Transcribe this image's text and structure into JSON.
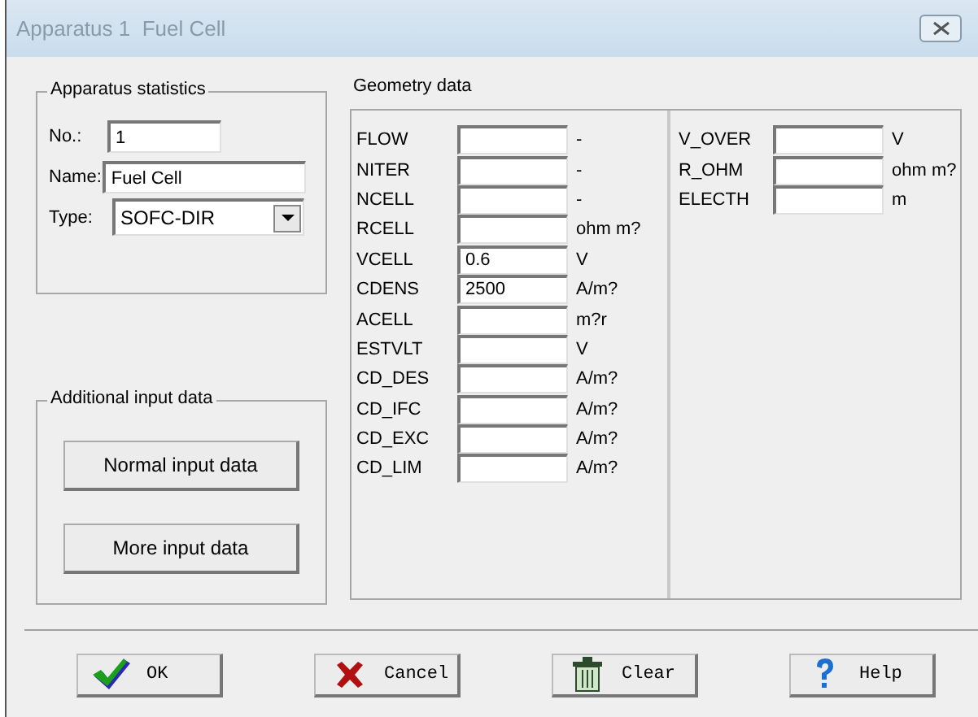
{
  "window": {
    "title": "Apparatus 1  Fuel Cell"
  },
  "statistics": {
    "title": "Apparatus statistics",
    "fields": [
      {
        "label": "No.:",
        "value": "1",
        "kind": "text"
      },
      {
        "label": "Name:",
        "value": "Fuel Cell",
        "kind": "text"
      },
      {
        "label": "Type:",
        "value": "SOFC-DIR",
        "kind": "dropdown"
      }
    ]
  },
  "additional": {
    "title": "Additional input data",
    "buttons": [
      "Normal input data",
      "More input data"
    ]
  },
  "geometry": {
    "title": "Geometry data",
    "columns": [
      [
        {
          "label": "FLOW",
          "unit": "-"
        },
        {
          "label": "NITER",
          "unit": "-"
        },
        {
          "label": "NCELL",
          "unit": "-"
        },
        {
          "label": "RCELL",
          "unit": "ohm m?"
        },
        {
          "label": "VCELL",
          "value": "0.6",
          "unit": "V"
        },
        {
          "label": "CDENS",
          "value": "2500",
          "unit": "A/m?"
        },
        {
          "label": "ACELL",
          "unit": "m?r"
        },
        {
          "label": "ESTVLT",
          "unit": "V"
        },
        {
          "label": "CD_DES",
          "unit": "A/m?"
        },
        {
          "label": "CD_IFC",
          "unit": "A/m?"
        },
        {
          "label": "CD_EXC",
          "unit": "A/m?"
        },
        {
          "label": "CD_LIM",
          "unit": "A/m?"
        }
      ],
      [
        {
          "label": "V_OVER",
          "unit": "V"
        },
        {
          "label": "R_OHM",
          "unit": "ohm m?"
        },
        {
          "label": "ELECTH",
          "unit": "m"
        }
      ]
    ]
  },
  "buttons": [
    {
      "label": "OK",
      "kind": "ok"
    },
    {
      "label": "Cancel",
      "kind": "cancel"
    },
    {
      "label": "Clear",
      "kind": "clear"
    },
    {
      "label": "Help",
      "kind": "help"
    }
  ]
}
